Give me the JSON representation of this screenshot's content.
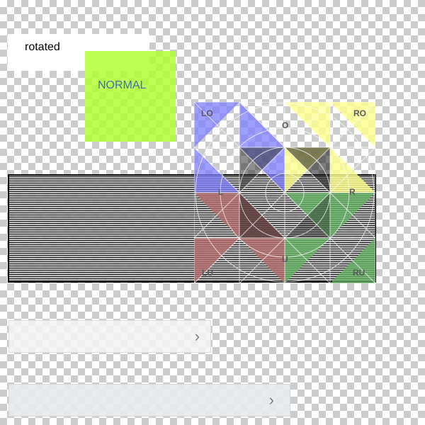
{
  "labels": {
    "rotated": "rotated",
    "normal": "NORMAL"
  },
  "grid": {
    "corner_labels": {
      "top_left": "LO",
      "top": "O",
      "top_right": "RO",
      "left": "L",
      "right": "R",
      "bottom_left": "LU",
      "bottom": "U",
      "bottom_right": "RU"
    }
  },
  "bars": {
    "bar_1_icon": "chevron-right-icon",
    "bar_2_icon": "chevron-right-icon",
    "bar_1_chevron": "›",
    "bar_2_chevron": "›"
  },
  "colors": {
    "normal_box": "#b0ff28",
    "normal_text": "#3f6fb1",
    "blue_tint": "#7d7dff",
    "yellow_tint": "#ffff8c",
    "red_tint": "#b56b6b",
    "green_tint": "#64b464"
  }
}
